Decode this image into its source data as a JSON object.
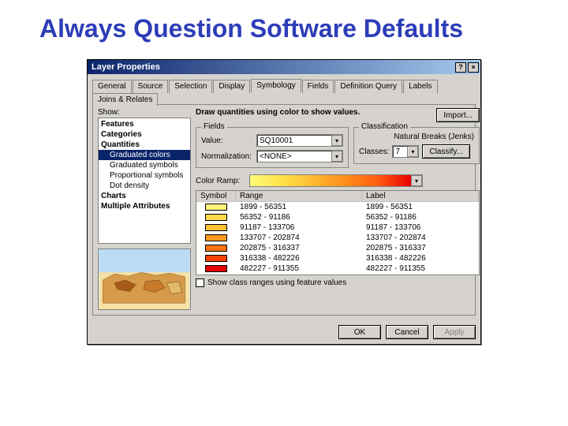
{
  "slide": {
    "title": "Always Question Software Defaults"
  },
  "window": {
    "title": "Layer Properties",
    "help_btn": "?",
    "close_btn": "×"
  },
  "tabs": [
    "General",
    "Source",
    "Selection",
    "Display",
    "Symbology",
    "Fields",
    "Definition Query",
    "Labels",
    "Joins & Relates"
  ],
  "active_tab": "Symbology",
  "show_label": "Show:",
  "show_tree": {
    "features": "Features",
    "categories": "Categories",
    "quantities": "Quantities",
    "q_items": [
      "Graduated colors",
      "Graduated symbols",
      "Proportional symbols",
      "Dot density"
    ],
    "q_selected": "Graduated colors",
    "charts": "Charts",
    "multiple_attrs": "Multiple Attributes"
  },
  "desc": "Draw quantities using color to show values.",
  "import_btn": "Import...",
  "fields_group": {
    "legend": "Fields",
    "value_label": "Value:",
    "value": "SQ10001",
    "norm_label": "Normalization:",
    "norm": "<NONE>"
  },
  "class_group": {
    "legend": "Classification",
    "method": "Natural Breaks (Jenks)",
    "classes_label": "Classes:",
    "classes": "7",
    "classify_btn": "Classify..."
  },
  "ramp_label": "Color Ramp:",
  "table": {
    "h_sym": "Symbol",
    "h_range": "Range",
    "h_label": "Label",
    "rows": [
      {
        "color": "#fff27a",
        "range": "1899 - 56351",
        "label": "1899 - 56351"
      },
      {
        "color": "#ffd94a",
        "range": "56352 - 91186",
        "label": "56352 - 91186"
      },
      {
        "color": "#ffbe33",
        "range": "91187 - 133706",
        "label": "91187 - 133706"
      },
      {
        "color": "#ff9a1f",
        "range": "133707 - 202874",
        "label": "133707 - 202874"
      },
      {
        "color": "#ff7412",
        "range": "202875 - 316337",
        "label": "202875 - 316337"
      },
      {
        "color": "#ff4308",
        "range": "316338 - 482226",
        "label": "316338 - 482226"
      },
      {
        "color": "#e60000",
        "range": "482227 - 911355",
        "label": "482227 - 911355"
      }
    ]
  },
  "chk_text": "Show class ranges using feature values",
  "buttons": {
    "ok": "OK",
    "cancel": "Cancel",
    "apply": "Apply"
  }
}
